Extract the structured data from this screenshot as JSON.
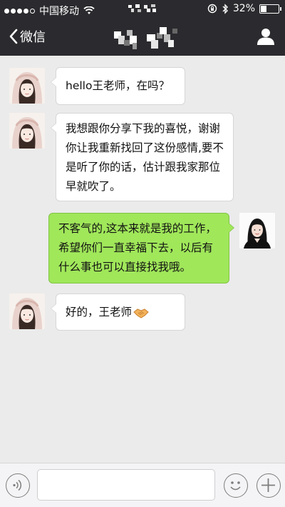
{
  "status_bar": {
    "carrier": "中国移动",
    "battery_text": "32%",
    "battery_level_percent": 32
  },
  "nav": {
    "back_label": "微信"
  },
  "messages": [
    {
      "side": "left",
      "text": "hello王老师，在吗？"
    },
    {
      "side": "left",
      "lines": [
        "我想跟你分享下我的喜悦，谢谢",
        "你让我重新找回了这份感情,要不",
        "是听了你的话，估计跟我家那位",
        "早就吹了。"
      ]
    },
    {
      "side": "right",
      "lines": [
        "不客气的,这本来就是我的工作，",
        "希望你们一直幸福下去，以后有",
        "什么事也可以直接找我哦。"
      ]
    },
    {
      "side": "left",
      "text": "好的，王老师",
      "emoji": "handshake-icon"
    }
  ],
  "icons": {
    "signal": "signal-dots-icon",
    "wifi": "wifi-icon",
    "lock": "rotation-lock-icon",
    "bluetooth": "bluetooth-icon",
    "battery": "battery-icon",
    "back": "chevron-left-icon",
    "profile": "person-icon",
    "voice": "voice-icon",
    "emoji": "smiley-icon",
    "plus": "plus-icon"
  },
  "colors": {
    "bar": "#2b2b2f",
    "background": "#ebebeb",
    "sent_bubble": "#a0e75a",
    "received_bubble": "#ffffff"
  }
}
